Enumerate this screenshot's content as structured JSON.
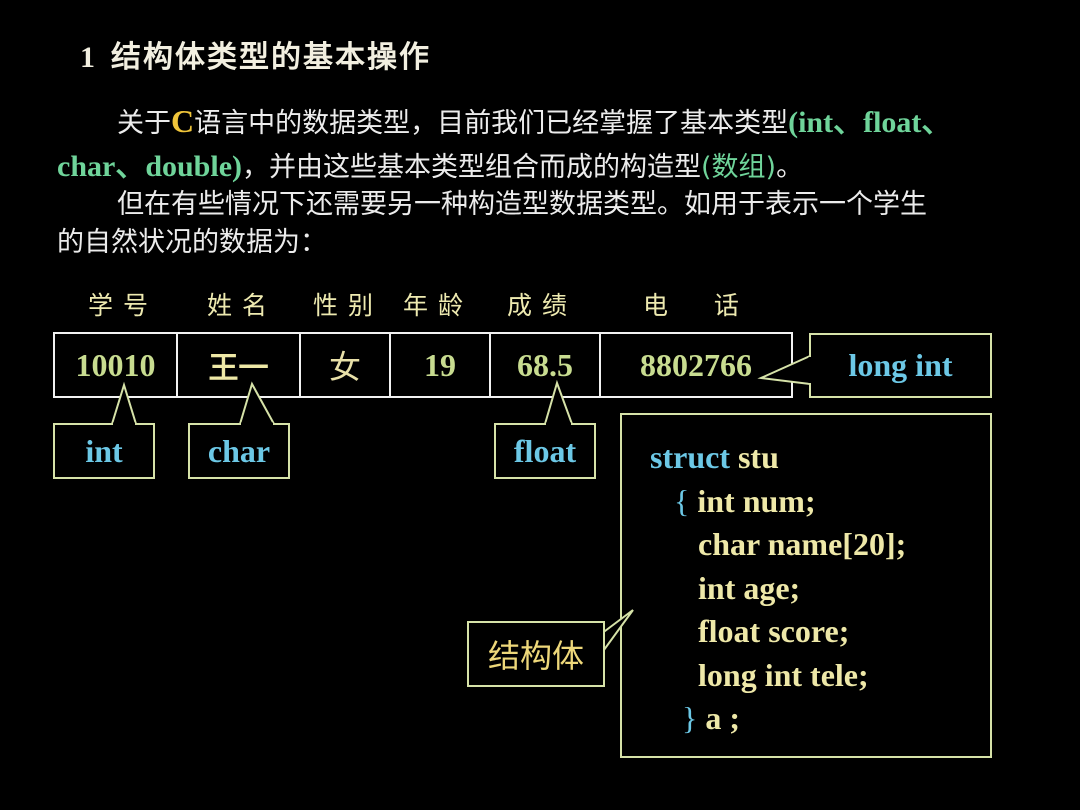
{
  "title": {
    "number": "1",
    "text": "结构体类型的基本操作"
  },
  "paragraph1": {
    "seg1": "关于",
    "c_letter": "C",
    "seg2": "语言中的数据类型，目前我们已经掌握了基本类型",
    "types_line1": "(int、float、",
    "types_line2": "char、double)",
    "seg3": "，并由这些基本类型组合而成的构造型",
    "array_paren": "(数组)",
    "seg4": "。"
  },
  "paragraph2": {
    "line1": "但在有些情况下还需要另一种构造型数据类型。如用于表示一个学生",
    "line2": "的自然状况的数据为："
  },
  "record": {
    "headers": [
      "学号",
      "姓名",
      "性别",
      "年龄",
      "成绩",
      "电  话"
    ],
    "values": [
      "10010",
      "王一",
      "女",
      "19",
      "68.5",
      "8802766"
    ]
  },
  "callouts": {
    "int": "int",
    "char": "char",
    "float": "float",
    "long_int": "long int",
    "struct_label": "结构体"
  },
  "code": {
    "line1_kw": "struct",
    "line1_rest": " stu",
    "line2_brace": "{",
    "line2_rest": " int num;",
    "line3": "char name[20];",
    "line4": "int age;",
    "line5": "float score;",
    "line6": "long int tele;",
    "line7_brace": "}",
    "line7_rest": " a ;"
  }
}
